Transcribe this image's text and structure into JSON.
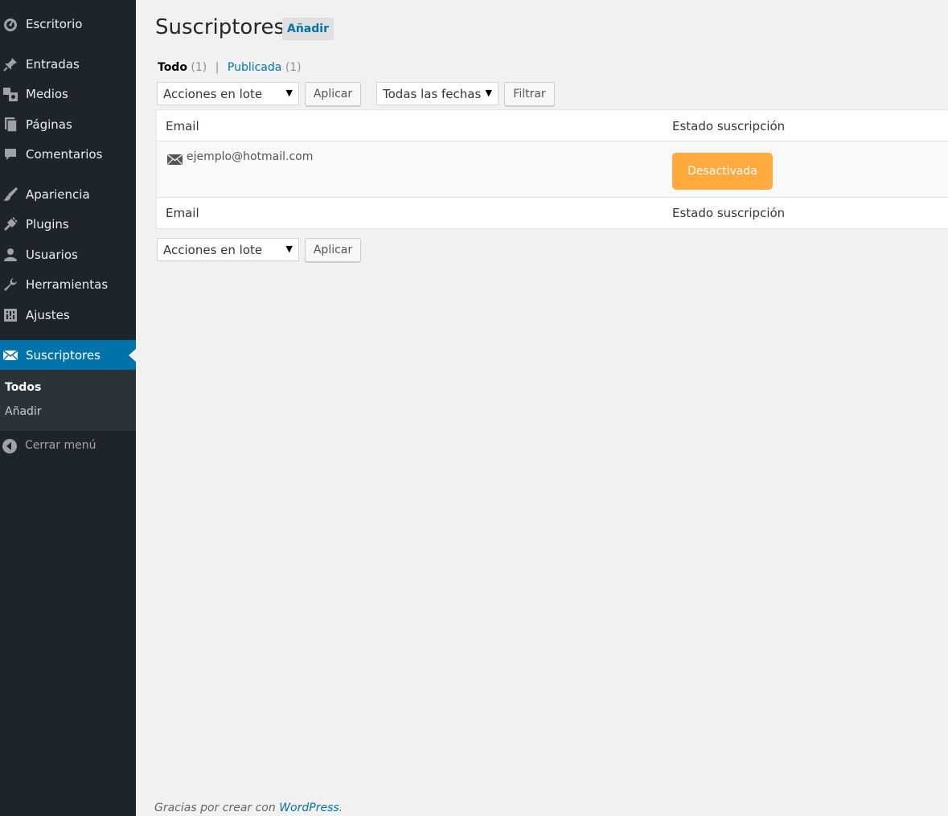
{
  "sidebar": {
    "items": [
      {
        "label": "Escritorio",
        "icon": "dashboard-icon"
      },
      {
        "label": "Entradas",
        "icon": "pin-icon"
      },
      {
        "label": "Medios",
        "icon": "media-icon"
      },
      {
        "label": "Páginas",
        "icon": "pages-icon"
      },
      {
        "label": "Comentarios",
        "icon": "comment-icon"
      },
      {
        "label": "Apariencia",
        "icon": "brush-icon"
      },
      {
        "label": "Plugins",
        "icon": "plug-icon"
      },
      {
        "label": "Usuarios",
        "icon": "user-icon"
      },
      {
        "label": "Herramientas",
        "icon": "wrench-icon"
      },
      {
        "label": "Ajustes",
        "icon": "settings-icon"
      },
      {
        "label": "Suscriptores",
        "icon": "mail-icon"
      }
    ],
    "submenu": [
      "Todos",
      "Añadir"
    ],
    "collapse_label": "Cerrar menú"
  },
  "page": {
    "title": "Suscriptores",
    "add_new_label": "Añadir"
  },
  "filters": {
    "all_label": "Todo",
    "all_count": "(1)",
    "separator": "|",
    "published_label": "Publicada",
    "published_count": "(1)"
  },
  "actions": {
    "bulk_label": "Acciones en lote",
    "apply_label": "Aplicar",
    "dates_label": "Todas las fechas",
    "filter_label": "Filtrar"
  },
  "table": {
    "columns": [
      "Email",
      "Estado suscripción"
    ],
    "rows": [
      {
        "email": "ejemplo@hotmail.com",
        "status": "Desactivada"
      }
    ]
  },
  "footer": {
    "text": "Gracias por crear con ",
    "link": "WordPress",
    "suffix": "."
  },
  "colors": {
    "sidebar_bg": "#1e242b",
    "accent": "#0073aa",
    "status_button": "#ffaa3f",
    "page_bg": "#f1f1f1"
  }
}
